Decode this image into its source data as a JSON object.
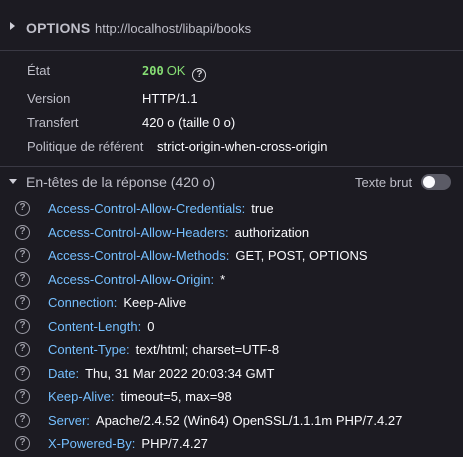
{
  "request": {
    "method": "OPTIONS",
    "url": "http://localhost/libapi/books"
  },
  "summary": {
    "status_label": "État",
    "status_code": "200",
    "status_text": "OK",
    "version_label": "Version",
    "version_value": "HTTP/1.1",
    "transfer_label": "Transfert",
    "transfer_value": "420 o (taille 0 o)",
    "referrer_label": "Politique de référent",
    "referrer_value": "strict-origin-when-cross-origin"
  },
  "response_headers": {
    "title": "En-têtes de la réponse (420 o)",
    "raw_label": "Texte brut",
    "raw_enabled": false,
    "items": [
      {
        "name": "Access-Control-Allow-Credentials:",
        "value": "true"
      },
      {
        "name": "Access-Control-Allow-Headers:",
        "value": "authorization"
      },
      {
        "name": "Access-Control-Allow-Methods:",
        "value": "GET, POST, OPTIONS"
      },
      {
        "name": "Access-Control-Allow-Origin:",
        "value": "*"
      },
      {
        "name": "Connection:",
        "value": "Keep-Alive"
      },
      {
        "name": "Content-Length:",
        "value": "0"
      },
      {
        "name": "Content-Type:",
        "value": "text/html; charset=UTF-8"
      },
      {
        "name": "Date:",
        "value": "Thu, 31 Mar 2022 20:03:34 GMT"
      },
      {
        "name": "Keep-Alive:",
        "value": "timeout=5, max=98"
      },
      {
        "name": "Server:",
        "value": "Apache/2.4.52 (Win64) OpenSSL/1.1.1m PHP/7.4.27"
      },
      {
        "name": "X-Powered-By:",
        "value": "PHP/7.4.27"
      }
    ]
  },
  "colors": {
    "background": "#1c1b22",
    "header_name": "#75bfff",
    "status_ok": "#86de74"
  }
}
